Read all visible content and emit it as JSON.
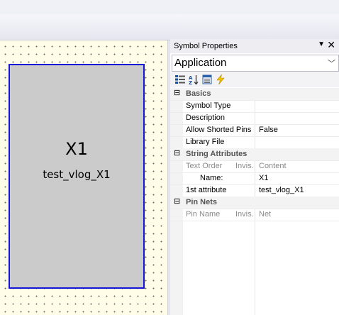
{
  "schematic": {
    "instance_name": "X1",
    "attribute_text": "test_vlog_X1"
  },
  "panel": {
    "title": "Symbol Properties",
    "pin_glyph": "▼",
    "close_glyph": "✕",
    "dropdown": {
      "value": "Application",
      "arrow": "﹀"
    },
    "toolbar": [
      "categorized-icon",
      "alphabetical-icon",
      "property-pages-icon",
      "events-icon"
    ]
  },
  "properties": {
    "basics": {
      "category": "Basics",
      "toggle": "⊟",
      "symbol_type": {
        "label": "Symbol Type",
        "value": ""
      },
      "description": {
        "label": "Description",
        "value": ""
      },
      "allow_shorted_pins": {
        "label": "Allow Shorted Pins",
        "value": "False"
      },
      "library_file": {
        "label": "Library File",
        "value": ""
      }
    },
    "string_attributes": {
      "category": "String Attributes",
      "toggle": "⊟",
      "header": {
        "text_order": "Text Order",
        "invis": "Invis.",
        "content": "Content"
      },
      "name": {
        "label": "Name:",
        "value": "X1"
      },
      "first_attribute": {
        "label": "1st attribute",
        "value": "test_vlog_X1"
      }
    },
    "pin_nets": {
      "category": "Pin Nets",
      "toggle": "⊟",
      "header": {
        "pin_name": "Pin Name",
        "invis": "Invis.",
        "net": "Net"
      }
    }
  }
}
